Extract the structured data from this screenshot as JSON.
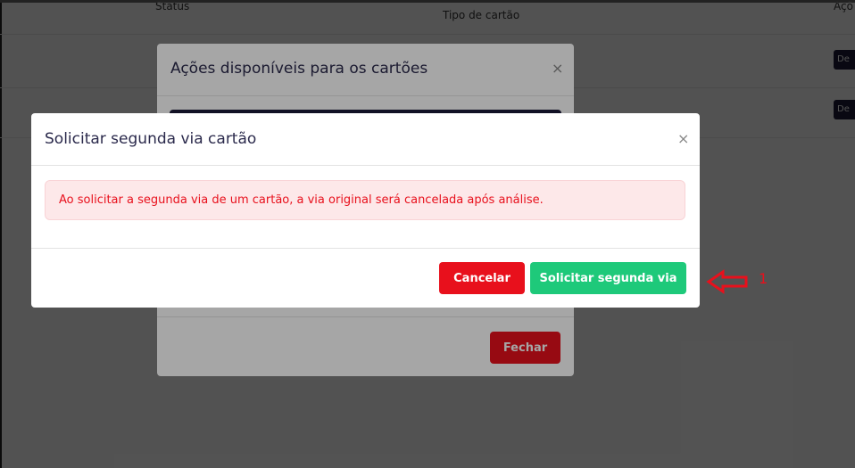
{
  "background": {
    "table_headers": {
      "status": "Status",
      "tipo": "Tipo de cartão",
      "acoes": "Açõ"
    },
    "row_buttons": [
      "De",
      "De"
    ]
  },
  "modal_back": {
    "title": "Ações disponíveis para os cartões",
    "close_symbol": "×",
    "fechar_label": "Fechar"
  },
  "modal_front": {
    "title": "Solicitar segunda via cartão",
    "close_symbol": "×",
    "alert_text": "Ao solicitar a segunda via de um cartão, a via original será cancelada após análise.",
    "cancel_label": "Cancelar",
    "confirm_label": "Solicitar segunda via"
  },
  "annotation": {
    "number": "1",
    "icon": "arrow-left-outline-icon",
    "color": "#e8101c"
  },
  "colors": {
    "danger": "#e8101c",
    "success": "#1ec97a",
    "title": "#2b2a4c",
    "alert_bg": "#fde8e9",
    "dark": "#1d1b3a"
  }
}
